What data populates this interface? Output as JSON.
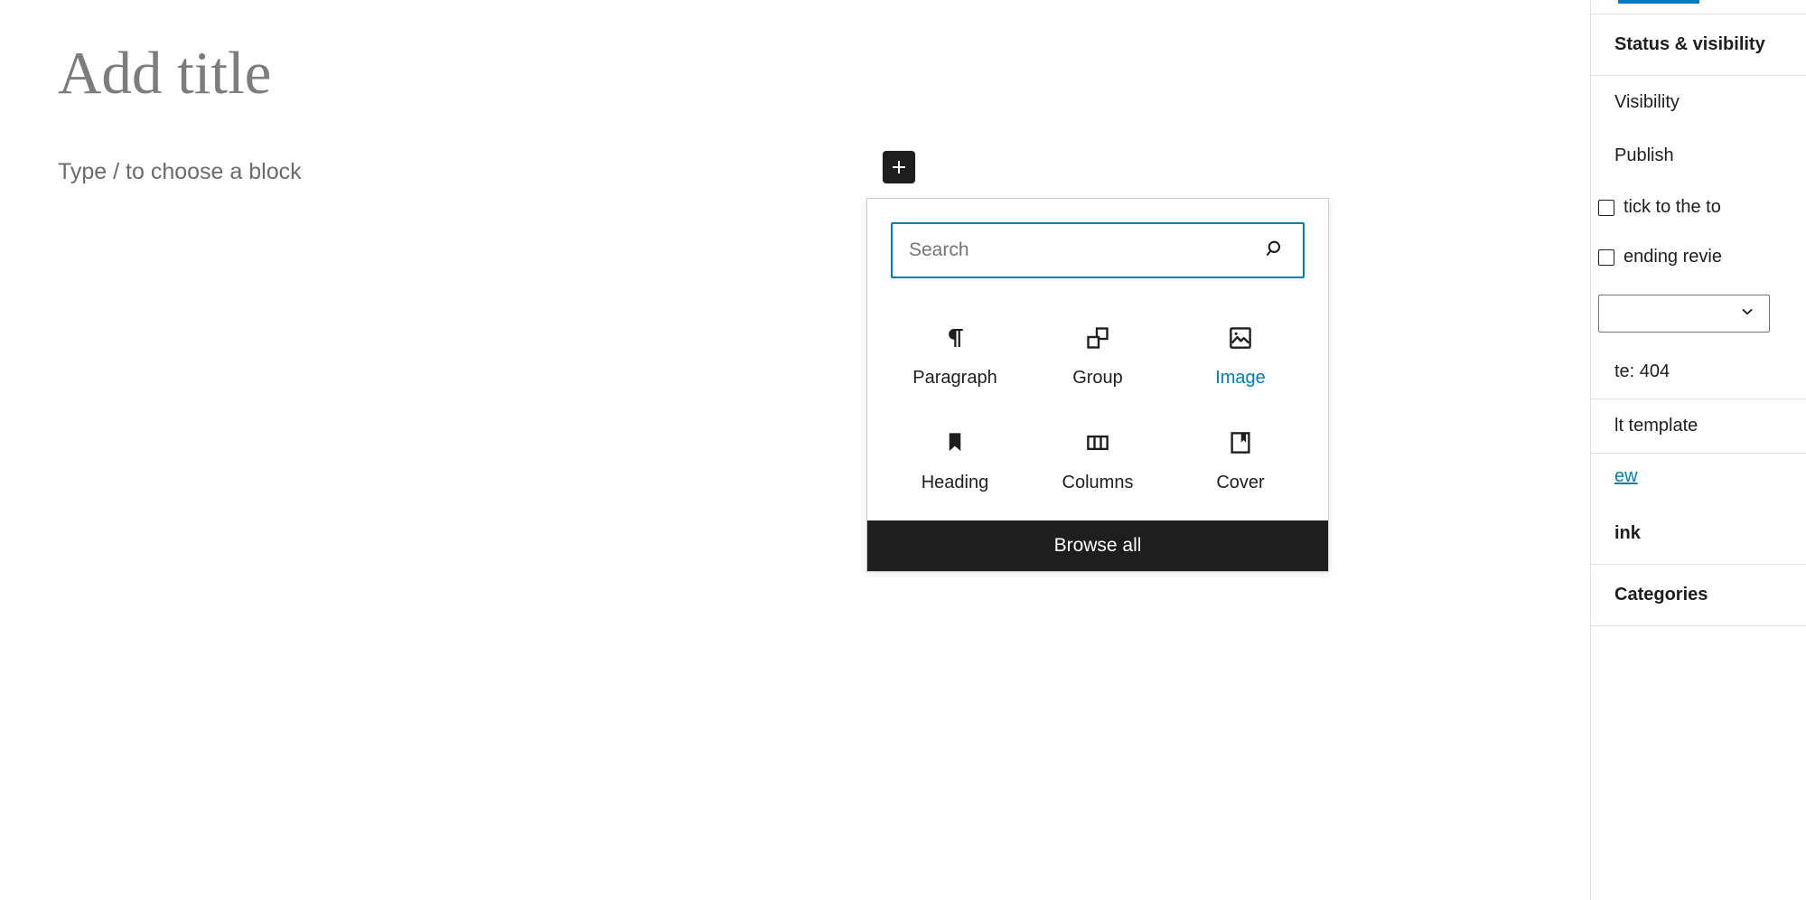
{
  "editor": {
    "title_placeholder": "Add title",
    "block_placeholder": "Type / to choose a block",
    "inserter_toggle_name": "plus-icon"
  },
  "inserter": {
    "search": {
      "placeholder": "Search",
      "value": "",
      "icon": "search-icon",
      "border_color": "#007cba"
    },
    "blocks": [
      {
        "label": "Paragraph",
        "icon": "paragraph-icon",
        "active": false
      },
      {
        "label": "Group",
        "icon": "group-icon",
        "active": false
      },
      {
        "label": "Image",
        "icon": "image-icon",
        "active": true
      },
      {
        "label": "Heading",
        "icon": "heading-icon",
        "active": false
      },
      {
        "label": "Columns",
        "icon": "columns-icon",
        "active": false
      },
      {
        "label": "Cover",
        "icon": "cover-icon",
        "active": false
      }
    ],
    "browse_all_label": "Browse all",
    "browse_all_bg": "#1e1e1e"
  },
  "sidebar": {
    "tab_accent": "#007cba",
    "status_panel_title": "Status & visibility",
    "visibility_label": "Visibility",
    "publish_label": "Publish",
    "stick_to_top_label": "tick to the to",
    "pending_review_label": "ending revie",
    "template_label": "te: 404",
    "default_template_label": "lt template",
    "preview_link_label": "ew",
    "permalink_title": "ink",
    "categories_title": "Categories"
  }
}
